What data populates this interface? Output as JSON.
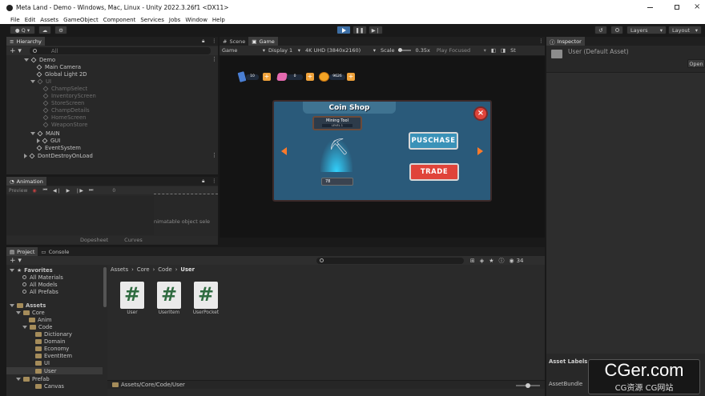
{
  "window": {
    "title": "Meta Land - Demo - Windows, Mac, Linux - Unity 2022.3.26f1 <DX11>"
  },
  "menu": [
    "File",
    "Edit",
    "Assets",
    "GameObject",
    "Component",
    "Services",
    "Jobs",
    "Window",
    "Help"
  ],
  "toolbar": {
    "account": "Q",
    "layers": "Layers",
    "layout": "Layout"
  },
  "hierarchy": {
    "tab": "Hierarchy",
    "search_placeholder": "All",
    "items": [
      "Demo",
      "Main Camera",
      "Global Light 2D",
      "UI",
      "ChampSelect",
      "InventoryScreen",
      "StoreScreen",
      "ChampDetails",
      "HomeScreen",
      "WeaponStore",
      "MAIN",
      "GUI",
      "EventSystem",
      "DontDestroyOnLoad"
    ]
  },
  "animation": {
    "tab": "Animation",
    "preview": "Preview",
    "frame": "0",
    "message": "nimatable object sele",
    "dopesheet": "Dopesheet",
    "curves": "Curves"
  },
  "scene_tabs": {
    "scene": "Scene",
    "game": "Game"
  },
  "game_toolbar": {
    "mode": "Game",
    "display": "Display 1",
    "resolution": "4K UHD (3840x2160)",
    "scale_label": "Scale",
    "scale_value": "0.35x",
    "play_focused": "Play Focused",
    "extra": "St"
  },
  "game_view": {
    "hud_values": [
      "10",
      "0",
      "9626"
    ],
    "title": "Coin Shop",
    "item_name": "Mining Tool",
    "item_level": "LEVEL 1",
    "price": "78",
    "purchase": "PUSCHASE",
    "trade": "TRADE",
    "colors": {
      "panel": "#2a5a7a",
      "title_bar": "#3f7391",
      "accent": "#ff6a2a",
      "glow": "#32d3ff"
    }
  },
  "inspector": {
    "tab": "Inspector",
    "object": "User (Default Asset)",
    "open": "Open",
    "asset_labels": "Asset Labels",
    "asset_bundle": "AssetBundle"
  },
  "project": {
    "tabs": [
      "Project",
      "Console"
    ],
    "favorites_label": "Favorites",
    "favorites": [
      "All Materials",
      "All Models",
      "All Prefabs"
    ],
    "assets_label": "Assets",
    "tree": [
      "Core",
      "Anim",
      "Code",
      "Dictionary",
      "Domain",
      "Economy",
      "EventItem",
      "UI",
      "User",
      "Prefab",
      "Canvas"
    ],
    "breadcrumb": [
      "Assets",
      "Core",
      "Code",
      "User"
    ],
    "files": [
      "User",
      "UserItem",
      "UserPocket"
    ],
    "path": "Assets/Core/Code/User",
    "count": "34"
  },
  "watermark": {
    "main": "CGer.com",
    "sub": "CG资源 CG网站"
  }
}
